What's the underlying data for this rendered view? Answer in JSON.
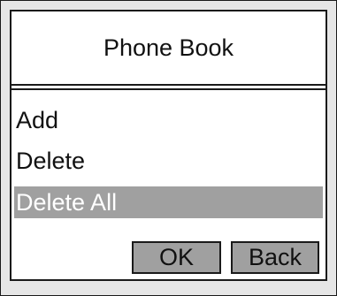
{
  "screen": {
    "title": "Phone Book"
  },
  "menu": {
    "items": [
      {
        "label": "Add",
        "selected": false
      },
      {
        "label": "Delete",
        "selected": false
      },
      {
        "label": "Delete All",
        "selected": true
      }
    ]
  },
  "softkeys": {
    "ok_label": "OK",
    "back_label": "Back"
  },
  "colors": {
    "selection": "#a0a0a0",
    "selection_text": "#ffffff",
    "outer_background": "#e6e6e6",
    "panel_background": "#ffffff"
  }
}
